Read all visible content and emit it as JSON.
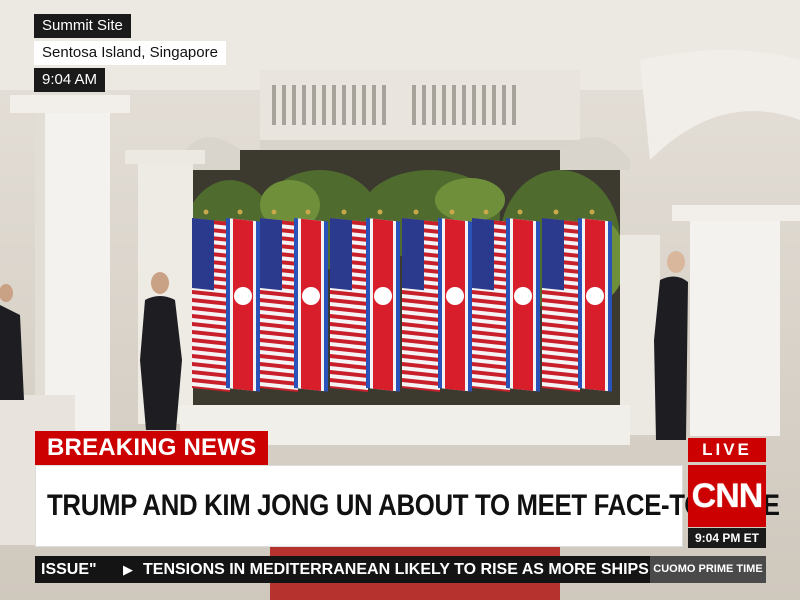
{
  "location": {
    "title": "Summit Site",
    "place": "Sentosa Island, Singapore",
    "time": "9:04 AM"
  },
  "lower_third": {
    "banner": "BREAKING NEWS",
    "headline": "TRUMP AND KIM JONG UN ABOUT TO MEET FACE-TO-FACE"
  },
  "network": {
    "live_label": "LIVE",
    "logo": "CNN",
    "clock": "9:04 PM ET"
  },
  "ticker": {
    "left_text": "ISSUE\"",
    "arrow_icon": "triangle-right-icon",
    "right_text": "TENSIONS IN MEDITERRANEAN LIKELY TO RISE AS MORE SHIPS",
    "show_name": "CUOMO PRIME TIME"
  },
  "colors": {
    "brand_red": "#cc0000",
    "banner_dark": "#1a1a1a"
  }
}
